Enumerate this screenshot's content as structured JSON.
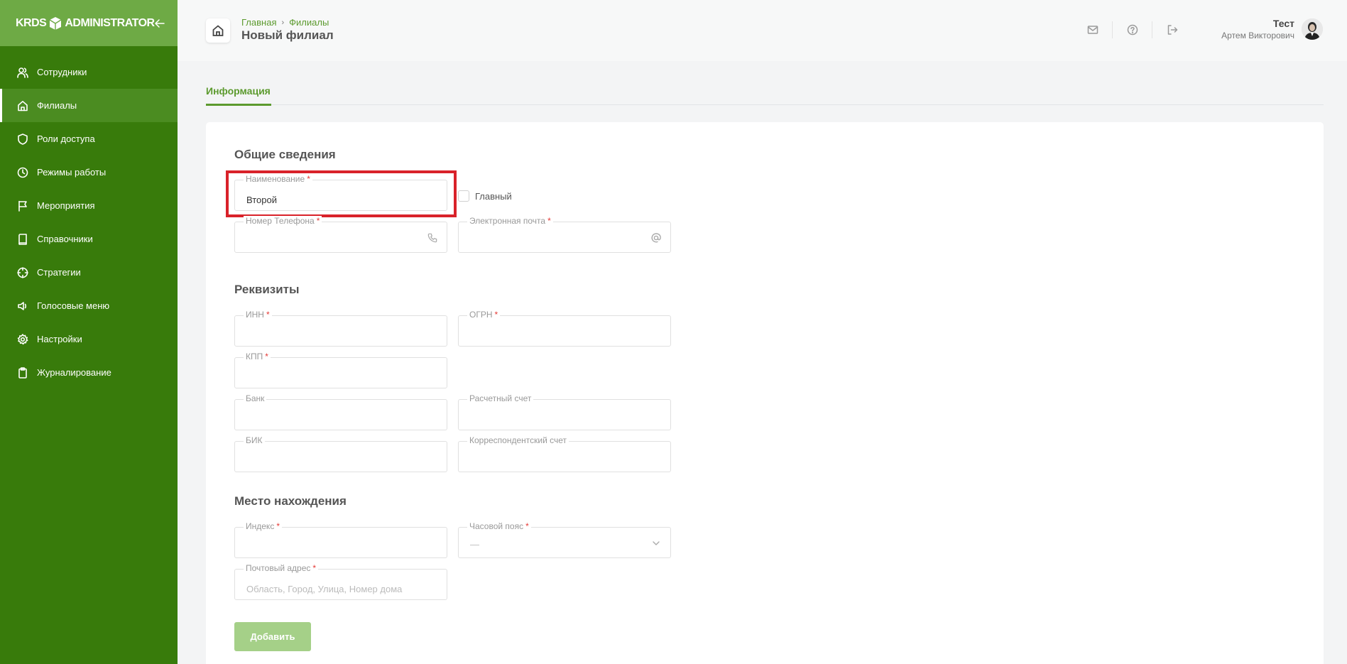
{
  "brand": {
    "logo_text_left": "KRDS",
    "logo_text_right": "ADMINISTRATOR",
    "collapse_icon": "arrow-left-icon"
  },
  "sidebar": {
    "items": [
      {
        "label": "Сотрудники",
        "icon": "users-icon",
        "active": false
      },
      {
        "label": "Филиалы",
        "icon": "home-icon",
        "active": true
      },
      {
        "label": "Роли доступа",
        "icon": "shield-icon",
        "active": false
      },
      {
        "label": "Режимы работы",
        "icon": "clock-icon",
        "active": false
      },
      {
        "label": "Мероприятия",
        "icon": "flag-icon",
        "active": false
      },
      {
        "label": "Справочники",
        "icon": "book-icon",
        "active": false
      },
      {
        "label": "Стратегии",
        "icon": "crosshair-icon",
        "active": false
      },
      {
        "label": "Голосовые меню",
        "icon": "speaker-icon",
        "active": false
      },
      {
        "label": "Настройки",
        "icon": "gear-icon",
        "active": false
      },
      {
        "label": "Журналирование",
        "icon": "clipboard-icon",
        "active": false
      }
    ]
  },
  "header": {
    "breadcrumb": [
      "Главная",
      "Филиалы"
    ],
    "title": "Новый филиал",
    "icons": [
      "mail-icon",
      "help-icon",
      "logout-icon"
    ],
    "user": {
      "first_name": "Тест",
      "full_name": "Артем Викторович"
    }
  },
  "tabs": [
    {
      "label": "Информация",
      "active": true
    }
  ],
  "form": {
    "general": {
      "title": "Общие сведения",
      "name": {
        "label": "Наименование",
        "value": "Второй",
        "required": true
      },
      "main_checkbox": {
        "label": "Главный",
        "checked": false
      },
      "phone": {
        "label": "Номер Телефона",
        "value": "",
        "required": true,
        "icon": "phone-icon"
      },
      "email": {
        "label": "Электронная почта",
        "value": "",
        "required": true,
        "icon": "at-icon"
      }
    },
    "requisites": {
      "title": "Реквизиты",
      "inn": {
        "label": "ИНН",
        "value": "",
        "required": true
      },
      "ogrn": {
        "label": "ОГРН",
        "value": "",
        "required": true
      },
      "kpp": {
        "label": "КПП",
        "value": "",
        "required": true
      },
      "bank": {
        "label": "Банк",
        "value": ""
      },
      "account": {
        "label": "Расчетный счет",
        "value": ""
      },
      "bik": {
        "label": "БИК",
        "value": ""
      },
      "corr_account": {
        "label": "Корреспондентский счет",
        "value": ""
      }
    },
    "location": {
      "title": "Место нахождения",
      "index": {
        "label": "Индекс",
        "value": "",
        "required": true
      },
      "timezone": {
        "label": "Часовой пояс",
        "value": "—",
        "required": true
      },
      "address": {
        "label": "Почтовый адрес",
        "value": "",
        "placeholder": "Область, Город, Улица, Номер дома",
        "required": true
      }
    },
    "submit_label": "Добавить"
  },
  "colors": {
    "sidebar": "#387b0b",
    "brand_bar": "#6eaa45",
    "accent": "#5c9a2e",
    "submit_disabled": "#a5d088",
    "highlight": "#d9222a"
  }
}
